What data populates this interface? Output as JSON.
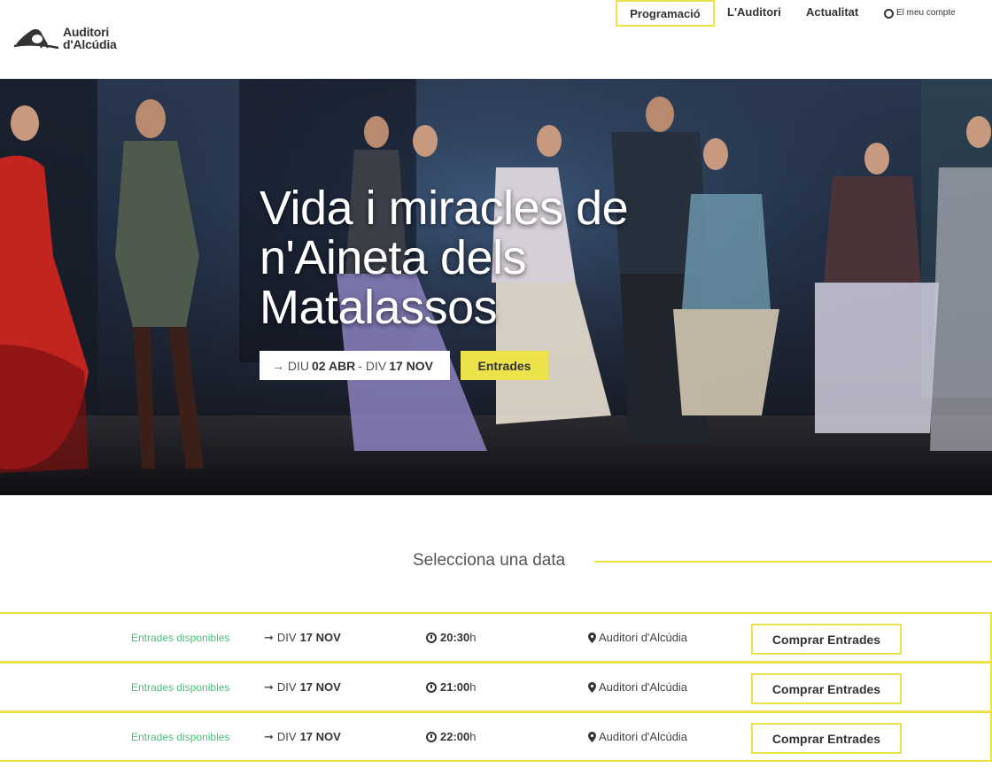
{
  "header": {
    "logo": {
      "line1": "Auditori",
      "line2": "d'Alcúdia"
    },
    "nav": [
      {
        "label": "Programació",
        "active": true
      },
      {
        "label": "L'Auditori"
      },
      {
        "label": "Actualitat"
      },
      {
        "label": "El meu compte",
        "icon": "account-circle-icon"
      }
    ]
  },
  "hero": {
    "title": "Vida i miracles de n'Aineta dels Matalassos",
    "dates": {
      "arrow": "→",
      "from_day": "DIU",
      "from_date": "02 ABR",
      "separator": "-",
      "to_day": "DIV",
      "to_date": "17 NOV"
    },
    "button": "Entrades"
  },
  "selection": {
    "title": "Selecciona una data"
  },
  "sessions": [
    {
      "availability": "Entrades disponibles",
      "day": "DIV",
      "date": "17 NOV",
      "time": "20:30",
      "time_suffix": "h",
      "place": "Auditori d'Alcúdia",
      "button": "Comprar Entrades"
    },
    {
      "availability": "Entrades disponibles",
      "day": "DIV",
      "date": "17 NOV",
      "time": "21:00",
      "time_suffix": "h",
      "place": "Auditori d'Alcúdia",
      "button": "Comprar Entrades"
    },
    {
      "availability": "Entrades disponibles",
      "day": "DIV",
      "date": "17 NOV",
      "time": "22:00",
      "time_suffix": "h",
      "place": "Auditori d'Alcúdia",
      "button": "Comprar Entrades"
    }
  ],
  "colors": {
    "accent": "#ece34a",
    "available": "#4fbf7a",
    "text": "#333333"
  }
}
